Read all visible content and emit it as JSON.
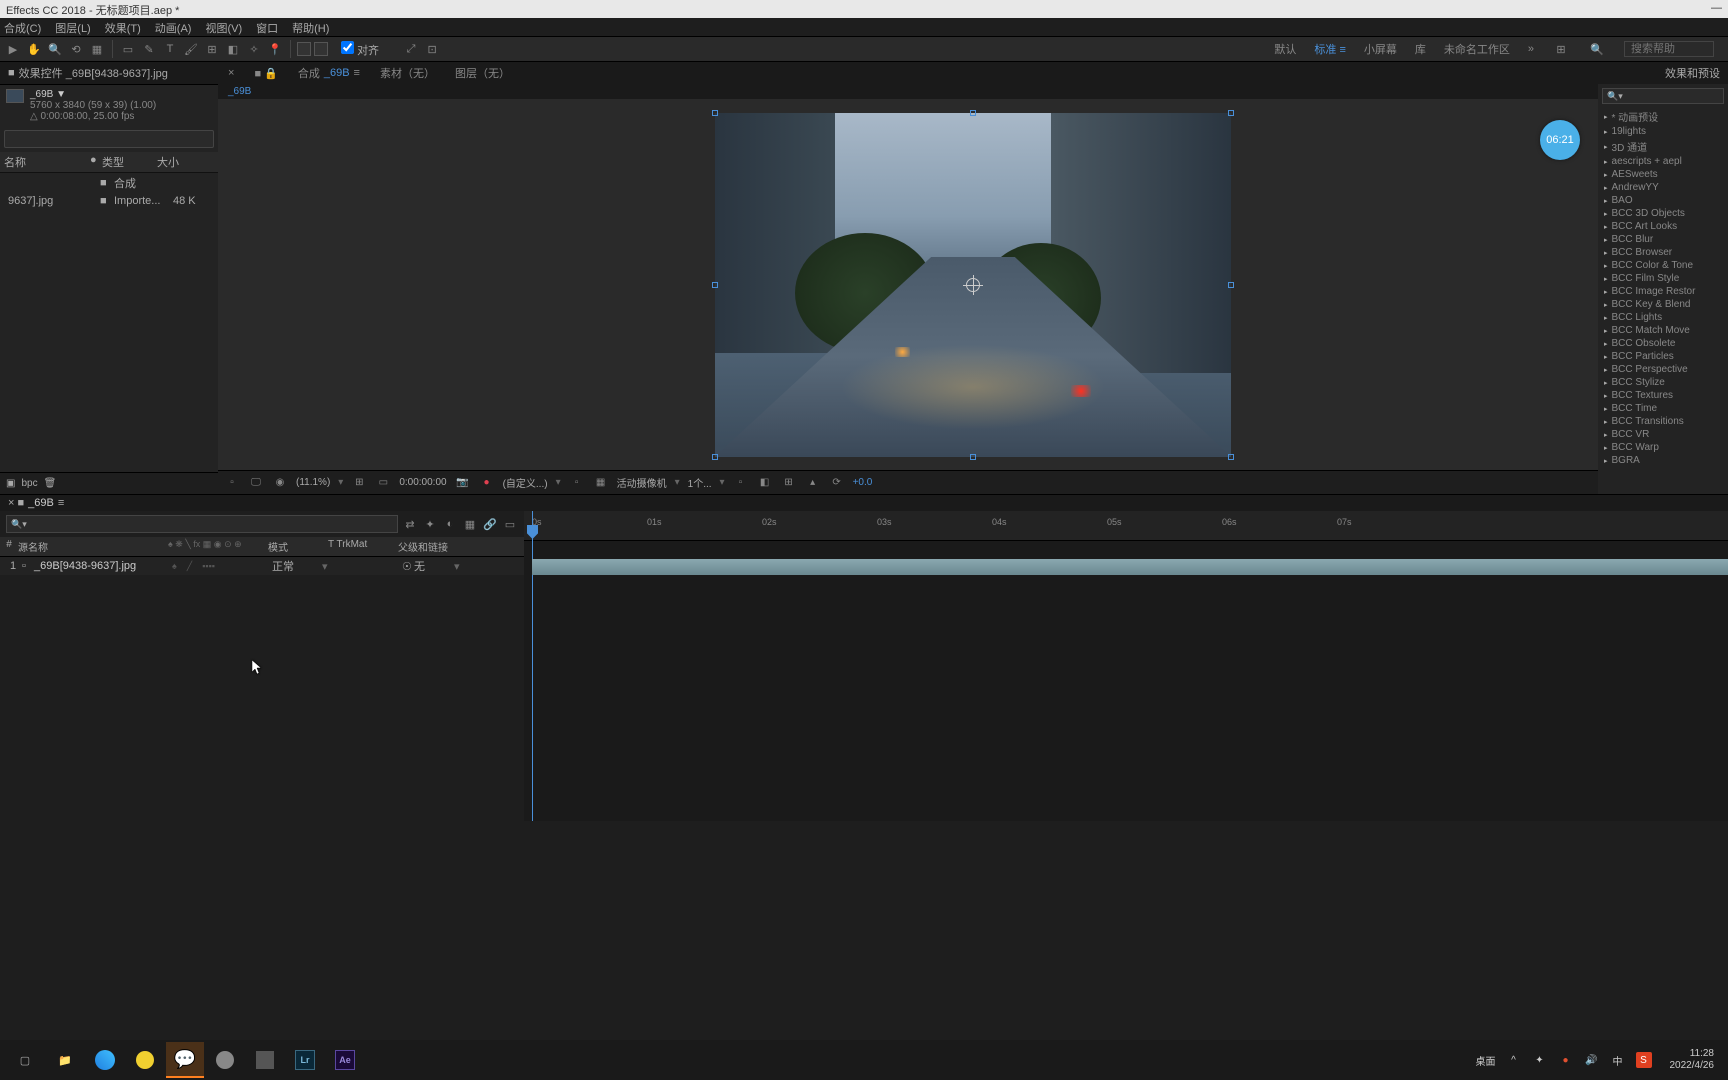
{
  "title": "Effects CC 2018 - 无标题项目.aep *",
  "menu": [
    "合成(C)",
    "图层(L)",
    "效果(T)",
    "动画(A)",
    "视图(V)",
    "窗口",
    "帮助(H)"
  ],
  "toolbar_checkbox": "对齐",
  "workspaces": {
    "default": "默认",
    "standard": "标准",
    "small": "小屏幕",
    "lib": "库",
    "unnamed": "未命名工作区"
  },
  "search_help": "搜索帮助",
  "left": {
    "tab": "效果控件 _69B[9438-9637].jpg",
    "comp_name": "_69B ▼",
    "res": "5760 x 3840  (59 x 39) (1.00)",
    "dur": "△ 0:00:08:00, 25.00 fps",
    "cols": {
      "name": "名称",
      "type": "类型",
      "size": "大小"
    },
    "rows": [
      {
        "name": "",
        "type": "合成",
        "size": ""
      },
      {
        "name": "9637].jpg",
        "type": "Importe...",
        "size": "48 K"
      }
    ],
    "footer_bpc": "bpc"
  },
  "center": {
    "tabs": {
      "comp": "合成",
      "comp_name": "_69B",
      "footage": "素材（无）",
      "layer": "图层（无）"
    },
    "subtab": "_69B",
    "footer": {
      "zoom": "(11.1%)",
      "time": "0:00:00:00",
      "custom": "(自定义...)",
      "camera": "活动摄像机",
      "view": "1个...",
      "exposure": "+0.0"
    }
  },
  "right": {
    "title": "效果和预设",
    "items": [
      "* 动画预设",
      "19lights",
      "3D 通道",
      "aescripts + aepl",
      "AESweets",
      "AndrewYY",
      "BAO",
      "BCC 3D Objects",
      "BCC Art Looks",
      "BCC Blur",
      "BCC Browser",
      "BCC Color & Tone",
      "BCC Film Style",
      "BCC Image Restor",
      "BCC Key & Blend",
      "BCC Lights",
      "BCC Match Move",
      "BCC Obsolete",
      "BCC Particles",
      "BCC Perspective",
      "BCC Stylize",
      "BCC Textures",
      "BCC Time",
      "BCC Transitions",
      "BCC VR",
      "BCC Warp",
      "BGRA"
    ]
  },
  "timeline": {
    "tab": "_69B",
    "cols": {
      "num": "#",
      "source": "源名称",
      "mode": "模式",
      "trkmat": "T  TrkMat",
      "parent": "父级和链接"
    },
    "layer": {
      "num": "1",
      "name": "_69B[9438-9637].jpg",
      "mode": "正常",
      "parent": "无"
    },
    "marks": [
      "0s",
      "01s",
      "02s",
      "03s",
      "04s",
      "05s",
      "06s",
      "07s"
    ]
  },
  "badge": "06:21",
  "taskbar": {
    "desktop": "桌面",
    "time": "11:28",
    "date": "2022/4/26",
    "ime": "中"
  }
}
